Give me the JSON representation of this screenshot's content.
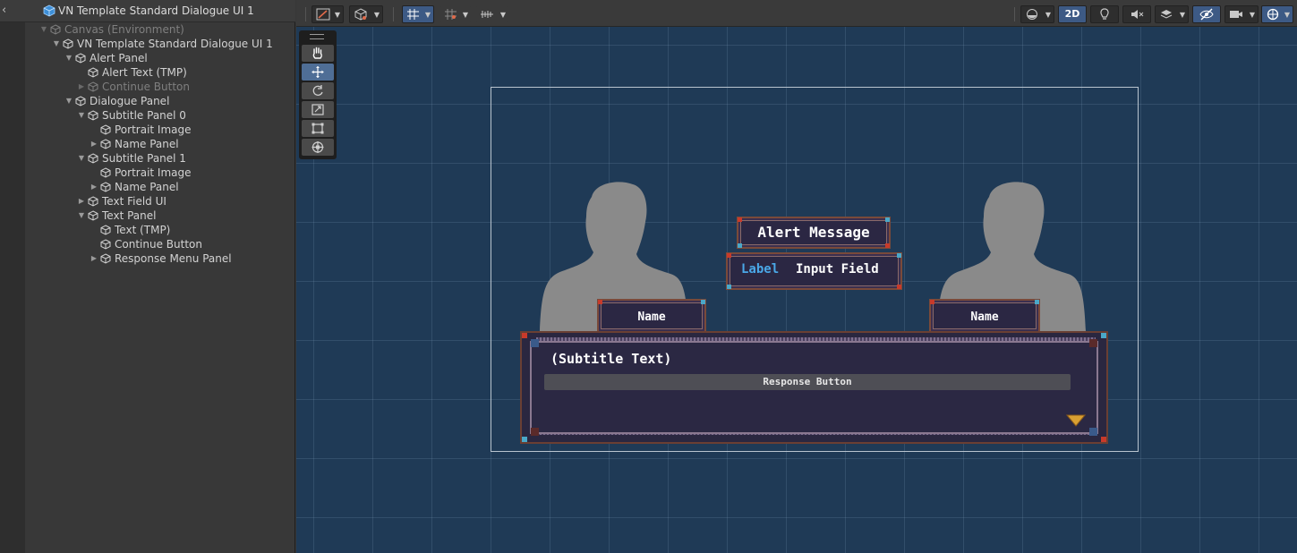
{
  "hierarchy": {
    "title": "VN Template Standard Dialogue UI 1",
    "items": [
      {
        "label": "Canvas (Environment)"
      },
      {
        "label": "VN Template Standard Dialogue UI 1"
      },
      {
        "label": "Alert Panel"
      },
      {
        "label": "Alert Text (TMP)"
      },
      {
        "label": "Continue Button"
      },
      {
        "label": "Dialogue Panel"
      },
      {
        "label": "Subtitle Panel 0"
      },
      {
        "label": "Portrait Image"
      },
      {
        "label": "Name Panel"
      },
      {
        "label": "Subtitle Panel 1"
      },
      {
        "label": "Portrait Image"
      },
      {
        "label": "Name Panel"
      },
      {
        "label": "Text Field UI"
      },
      {
        "label": "Text Panel"
      },
      {
        "label": "Text (TMP)"
      },
      {
        "label": "Continue Button"
      },
      {
        "label": "Response Menu Panel"
      }
    ]
  },
  "toolbar": {
    "mode_2d_label": "2D"
  },
  "scene": {
    "alert_message": "Alert Message",
    "field_label": "Label",
    "input_field": "Input Field",
    "name_left": "Name",
    "name_right": "Name",
    "subtitle_text": "(Subtitle Text)",
    "response_button": "Response Button"
  },
  "colors": {
    "scene_bg": "#1f3a56",
    "panel_bg": "#2b2743",
    "panel_border": "#7a4a3a",
    "accent_label": "#4aa8e8",
    "continue_arrow": "#d9a032",
    "active_tool": "#4f6e96"
  }
}
